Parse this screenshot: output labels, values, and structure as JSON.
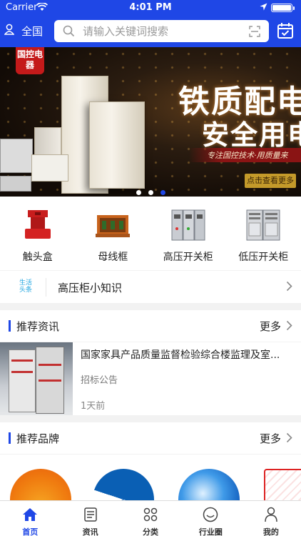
{
  "status_bar": {
    "carrier": "Carrier",
    "time": "4:01 PM",
    "battery_level": 1.0
  },
  "header": {
    "region_label": "全国",
    "search_placeholder": "请输入关键词搜索",
    "icons": [
      "user-location-icon",
      "search-icon",
      "scan-icon",
      "calendar-check-icon"
    ]
  },
  "banner": {
    "logo_text": "国控电器",
    "headline_line1": "铁质配电",
    "headline_line2": "安全用电",
    "tagline": "专注国控技术·用质量来",
    "cta_label": "点击查看更多",
    "slide_count": 3,
    "active_slide": 2
  },
  "categories": [
    {
      "label": "触头盒",
      "icon": "contact-box-icon"
    },
    {
      "label": "母线框",
      "icon": "busbar-frame-icon"
    },
    {
      "label": "高压开关柜",
      "icon": "high-voltage-cabinet-icon"
    },
    {
      "label": "低压开关柜",
      "icon": "low-voltage-cabinet-icon"
    }
  ],
  "headline_tip": {
    "logo_text": "生活头条",
    "text": "高压柜小知识"
  },
  "recommended_news": {
    "title": "推荐资讯",
    "more_label": "更多",
    "articles": [
      {
        "title": "国家家具产品质量监督检验综合楼监理及室...",
        "category": "招标公告",
        "time": "1天前"
      }
    ]
  },
  "recommended_brands": {
    "title": "推荐品牌",
    "more_label": "更多"
  },
  "tabbar": [
    {
      "label": "首页",
      "icon": "home-icon",
      "active": true
    },
    {
      "label": "资讯",
      "icon": "news-icon",
      "active": false
    },
    {
      "label": "分类",
      "icon": "category-icon",
      "active": false
    },
    {
      "label": "行业圈",
      "icon": "circle-icon",
      "active": false
    },
    {
      "label": "我的",
      "icon": "profile-icon",
      "active": false
    }
  ],
  "colors": {
    "primary": "#1f47e6",
    "background": "#f2f2f2",
    "tip_logo": "#23a6e0"
  }
}
